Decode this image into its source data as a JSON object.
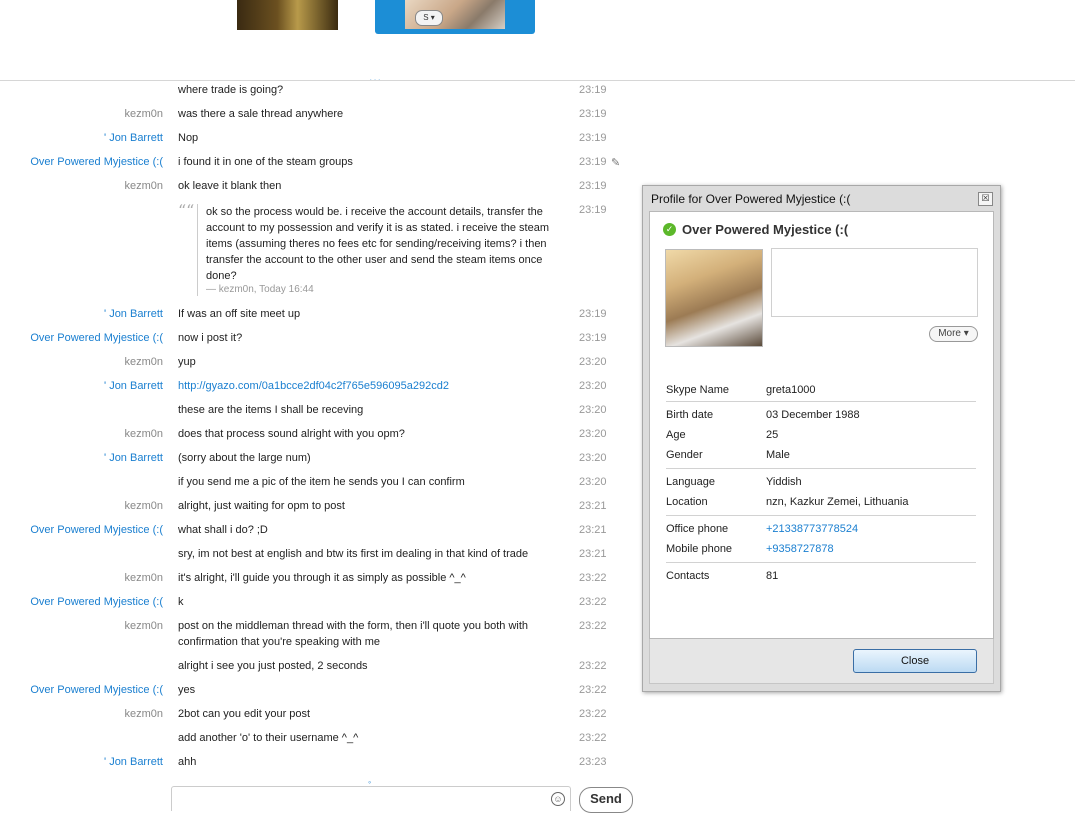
{
  "header": {
    "more_indicator": "..."
  },
  "messages": [
    {
      "sender": "",
      "text": "where trade is going?",
      "time": "23:19",
      "top": 0
    },
    {
      "sender": "kezm0n",
      "text": "was there a sale thread anywhere",
      "time": "23:19"
    },
    {
      "sender": "' Jon Barrett",
      "text": "Nop",
      "time": "23:19"
    },
    {
      "sender": "Over Powered Myjestice (:(",
      "text": "i found it in one of the steam groups",
      "time": "23:19"
    },
    {
      "sender": "kezm0n",
      "text": "ok leave it blank then",
      "time": "23:19"
    }
  ],
  "quote": {
    "mark": "““",
    "text": "ok so the process would be. i receive the account details, transfer the account to my possession and verify it is as stated. i receive the steam items (assuming theres no fees etc for sending/receiving items? i then transfer the account to the other user and send the steam items once done?",
    "source": "— kezm0n, Today 16:44",
    "time": "23:19"
  },
  "messages2": [
    {
      "sender": "' Jon Barrett",
      "text": "If was an off site meet up",
      "time": "23:19"
    },
    {
      "sender": "Over Powered Myjestice (:(",
      "text": "now i post it?",
      "time": "23:19"
    },
    {
      "sender": "kezm0n",
      "text": "yup",
      "time": "23:20"
    },
    {
      "sender": "' Jon Barrett",
      "text": "http://gyazo.com/0a1bcce2df04c2f765e596095a292cd2",
      "time": "23:20"
    },
    {
      "sender": "",
      "text": "these are the items I shall be receving",
      "time": "23:20"
    },
    {
      "sender": "kezm0n",
      "text": "does that process sound alright with you opm?",
      "time": "23:20"
    },
    {
      "sender": "' Jon Barrett",
      "text": "(sorry about the large num)",
      "time": "23:20"
    },
    {
      "sender": "",
      "text": "if you send me a pic of the item he sends you I can confirm",
      "time": "23:20"
    },
    {
      "sender": "kezm0n",
      "text": "alright, just waiting for opm to post",
      "time": "23:21"
    },
    {
      "sender": "Over Powered Myjestice (:(",
      "text": "what shall i do? ;D",
      "time": "23:21"
    },
    {
      "sender": "",
      "text": "sry, im not best at english and btw its first im dealing in that kind of trade",
      "time": "23:21"
    },
    {
      "sender": "kezm0n",
      "text": "it's alright, i'll guide you through it as simply as possible ^_^",
      "time": "23:22"
    },
    {
      "sender": "Over Powered Myjestice (:(",
      "text": "k",
      "time": "23:22"
    },
    {
      "sender": "kezm0n",
      "text": "post on the middleman thread with the form, then i'll quote you both with",
      "text2": "confirmation that you're speaking with me",
      "time": "23:22"
    },
    {
      "sender": "",
      "text": "alright i see you just posted, 2 seconds",
      "time": "23:22"
    },
    {
      "sender": "Over Powered Myjestice (:(",
      "text": "yes",
      "time": "23:22"
    },
    {
      "sender": "kezm0n",
      "text": "2bot can you edit your post",
      "time": "23:22"
    },
    {
      "sender": "",
      "text": "add another 'o' to their username ^_^",
      "time": "23:22"
    },
    {
      "sender": "' Jon Barrett",
      "text": "ahh",
      "time": "23:23"
    }
  ],
  "compose": {
    "send_label": "Send",
    "emoji": "☺"
  },
  "profile": {
    "title": "Profile for Over Powered Myjestice (:(",
    "close_x": "☒",
    "name": "Over Powered Myjestice (:(",
    "more_label": "More ▾",
    "fields": {
      "skype_name": {
        "k": "Skype Name",
        "v": "greta1000"
      },
      "birth_date": {
        "k": "Birth date",
        "v": "03 December 1988"
      },
      "age": {
        "k": "Age",
        "v": "25"
      },
      "gender": {
        "k": "Gender",
        "v": "Male"
      },
      "language": {
        "k": "Language",
        "v": "Yiddish"
      },
      "location": {
        "k": "Location",
        "v": "nzn, Kazkur Zemei, Lithuania"
      },
      "office_phone": {
        "k": "Office phone",
        "v": "+21338773778524"
      },
      "mobile_phone": {
        "k": "Mobile phone",
        "v": "+9358727878"
      },
      "contacts": {
        "k": "Contacts",
        "v": "81"
      }
    },
    "close_label": "Close"
  }
}
